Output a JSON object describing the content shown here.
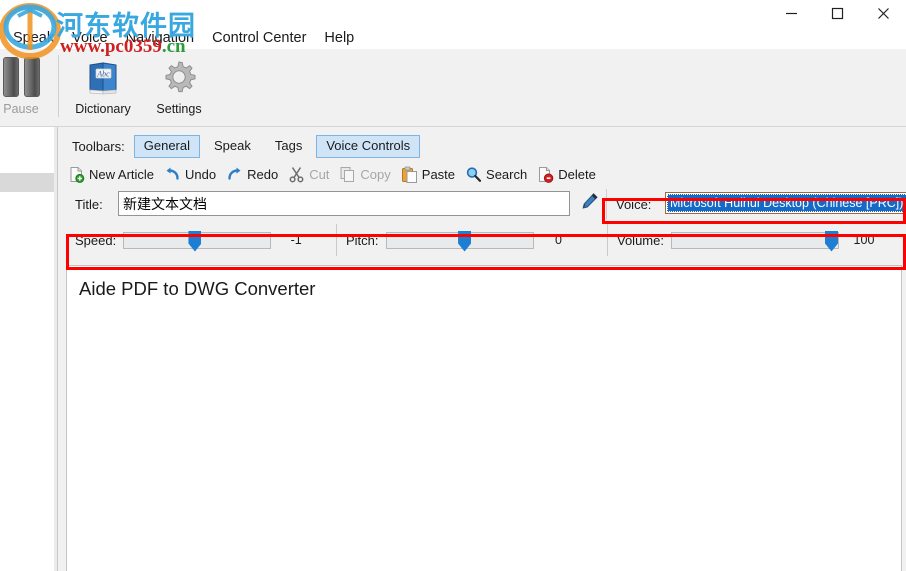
{
  "window": {
    "controls": [
      {
        "name": "minimize",
        "glyph": "minimize-icon"
      },
      {
        "name": "maximize",
        "glyph": "maximize-icon"
      },
      {
        "name": "close",
        "glyph": "close-icon"
      }
    ]
  },
  "menubar": {
    "items": [
      {
        "label": "Speak"
      },
      {
        "label": "Voice"
      },
      {
        "label": "Navigation"
      },
      {
        "label": "Control Center"
      },
      {
        "label": "Help"
      }
    ]
  },
  "bigbar": {
    "pause": {
      "label": "Pause",
      "icon": "pause-icon"
    },
    "dictionary": {
      "label": "Dictionary",
      "icon": "dictionary-icon",
      "badge": "Abc"
    },
    "settings": {
      "label": "Settings",
      "icon": "gear-icon"
    }
  },
  "toolbars": {
    "label": "Toolbars:",
    "chips": [
      {
        "label": "General",
        "active": true
      },
      {
        "label": "Speak",
        "active": false
      },
      {
        "label": "Tags",
        "active": false
      },
      {
        "label": "Voice Controls",
        "active": true
      }
    ]
  },
  "actions": [
    {
      "label": "New Article",
      "icon": "new-article-icon",
      "enabled": true
    },
    {
      "label": "Undo",
      "icon": "undo-icon",
      "enabled": true
    },
    {
      "label": "Redo",
      "icon": "redo-icon",
      "enabled": true
    },
    {
      "label": "Cut",
      "icon": "cut-icon",
      "enabled": false
    },
    {
      "label": "Copy",
      "icon": "copy-icon",
      "enabled": false
    },
    {
      "label": "Paste",
      "icon": "paste-icon",
      "enabled": true
    },
    {
      "label": "Search",
      "icon": "search-icon",
      "enabled": true
    },
    {
      "label": "Delete",
      "icon": "delete-icon",
      "enabled": true
    }
  ],
  "fields": {
    "title_label": "Title:",
    "title_value": "新建文本文档",
    "title_placeholder": "",
    "pen_icon": "pen-icon",
    "voice_label": "Voice:",
    "voice_value": "Microsoft Huihui Desktop (Chinese [PRC])"
  },
  "sliders": [
    {
      "name": "Speed:",
      "value": "-1",
      "thumb_pct": 44
    },
    {
      "name": "Pitch:",
      "value": "0",
      "thumb_pct": 50
    },
    {
      "name": "Volume:",
      "value": "100",
      "thumb_pct": 100
    }
  ],
  "editor": {
    "text": "Aide PDF to DWG Converter"
  },
  "watermark": {
    "chinese": "河东软件园",
    "url_main": "www.pc0359",
    "url_tld": ".cn"
  },
  "colors": {
    "accent_blue": "#1d7fd4",
    "chip_active_bg": "#cfe5f7",
    "chip_active_border": "#7fb5e0",
    "selection_blue": "#1569c7",
    "annotation_red": "#ff0000",
    "toolbar_bg": "#f1f1f1",
    "watermark_blue": "#3aa8e0",
    "watermark_red": "#cf1f1f"
  }
}
